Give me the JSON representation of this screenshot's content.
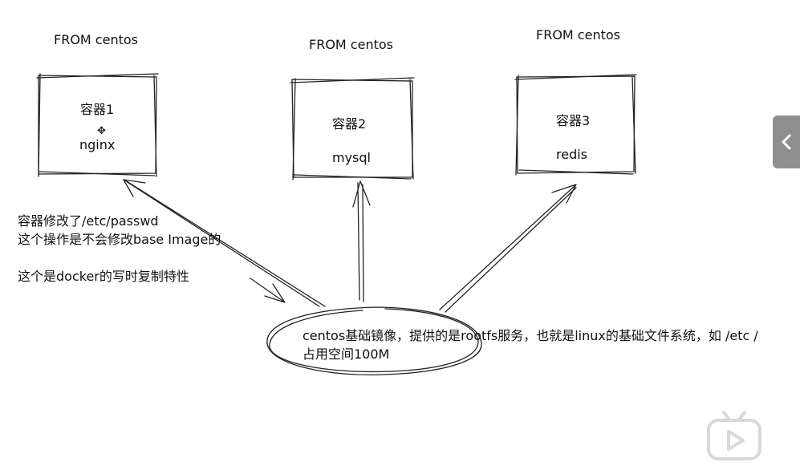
{
  "containers": [
    {
      "from": "FROM centos",
      "name": "容器1",
      "app": "nginx"
    },
    {
      "from": "FROM centos",
      "name": "容器2",
      "app": "mysql"
    },
    {
      "from": "FROM centos",
      "name": "容器3",
      "app": "redis"
    }
  ],
  "note": {
    "line1": "容器修改了/etc/passwd",
    "line2": "这个操作是不会修改base Image的",
    "line3": "这个是docker的写时复制特性"
  },
  "base": {
    "line1": "centos基础镜像，提供的是rootfs服务，也就是linux的基础文件系统，如 /etc /",
    "line2": "占用空间100M"
  },
  "ui": {
    "side_tab_icon": "chevron-left-icon",
    "logo_icon": "bilibili-tv-icon"
  }
}
